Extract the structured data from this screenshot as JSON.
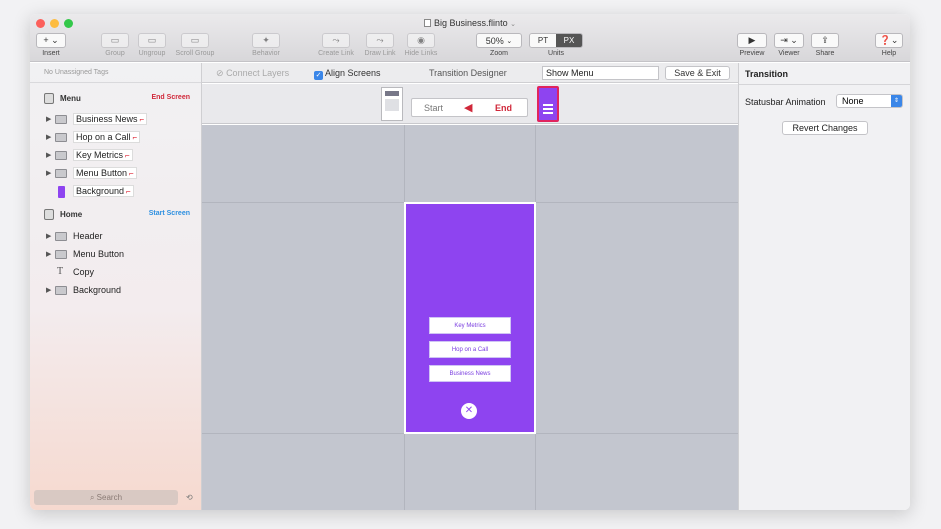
{
  "window": {
    "title": "Big Business.flinto"
  },
  "toolbar": {
    "insert": "Insert",
    "insert_btn": "+ ⌄",
    "group": "Group",
    "ungroup": "Ungroup",
    "scroll_group": "Scroll Group",
    "behavior": "Behavior",
    "create_link": "Create Link",
    "draw_link": "Draw Link",
    "hide_links": "Hide Links",
    "zoom_value": "50%",
    "zoom": "Zoom",
    "units_pt": "PT",
    "units_px": "PX",
    "units": "Units",
    "preview": "Preview",
    "viewer": "Viewer",
    "share": "Share",
    "help": "Help"
  },
  "sidebar": {
    "tags_label": "No Unassigned Tags",
    "menu_screen": {
      "name": "Menu",
      "tag": "End Screen",
      "layers": [
        "Business News",
        "Hop on a Call",
        "Key Metrics",
        "Menu Button",
        "Background"
      ]
    },
    "home_screen": {
      "name": "Home",
      "tag": "Start Screen",
      "layers": [
        "Header",
        "Menu Button",
        "Copy",
        "Background"
      ]
    },
    "search_placeholder": "Search"
  },
  "canvas_bar": {
    "connect_layers": "Connect Layers",
    "align_screens": "Align Screens",
    "transition_designer": "Transition Designer",
    "transition_name": "Show Menu",
    "save_exit": "Save & Exit"
  },
  "designer": {
    "start": "Start",
    "end": "End"
  },
  "phone": {
    "buttons": [
      "Key Metrics",
      "Hop on a Call",
      "Business News"
    ],
    "close": "✕"
  },
  "inspector": {
    "title": "Transition",
    "statusbar_label": "Statusbar Animation",
    "statusbar_value": "None",
    "revert": "Revert Changes"
  },
  "colors": {
    "accent": "#8e44f0",
    "end_red": "#d0283a",
    "start_blue": "#2d8fe0"
  }
}
